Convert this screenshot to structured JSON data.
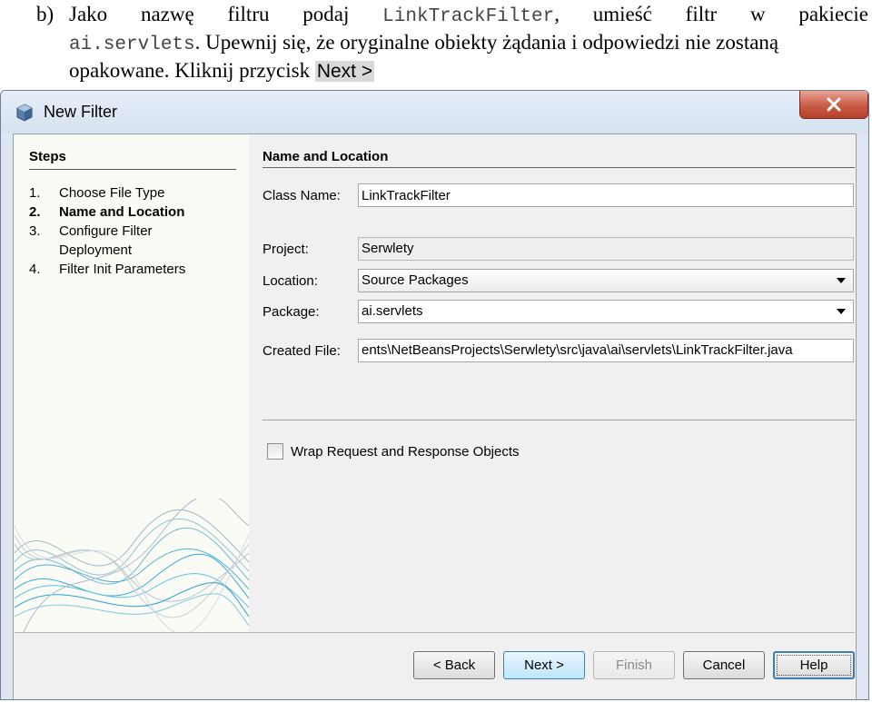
{
  "doc": {
    "marker": "b)",
    "line1_words": [
      "Jako",
      "nazwę",
      "filtru",
      "podaj"
    ],
    "filter_name": "LinkTrackFilter",
    "line1_tail_words": [
      ",",
      "umieść",
      "filtr",
      "w",
      "pakiecie"
    ],
    "package_code": "ai.servlets",
    "line2_text": ". Upewnij się, że oryginalne obiekty żądania i odpowiedzi nie zostaną",
    "line3_text": "opakowane. Kliknij przycisk",
    "button_ref": "Next >"
  },
  "window": {
    "title": "New Filter",
    "close_icon": "close-x-icon"
  },
  "steps": {
    "title": "Steps",
    "items": [
      {
        "num": "1.",
        "label": "Choose File Type"
      },
      {
        "num": "2.",
        "label": "Name and Location"
      },
      {
        "num": "3.",
        "label": "Configure Filter"
      },
      {
        "num": "",
        "label": "Deployment"
      },
      {
        "num": "4.",
        "label": "Filter Init Parameters"
      }
    ]
  },
  "panel": {
    "title": "Name and Location",
    "class_name_label": "Class Name:",
    "class_name_value": "LinkTrackFilter",
    "project_label": "Project:",
    "project_value": "Serwlety",
    "location_label": "Location:",
    "location_value": "Source Packages",
    "package_label": "Package:",
    "package_value": "ai.servlets",
    "created_file_label": "Created File:",
    "created_file_value": "ents\\NetBeansProjects\\Serwlety\\src\\java\\ai\\servlets\\LinkTrackFilter.java",
    "wrap_label": "Wrap Request and Response Objects",
    "wrap_checked": false
  },
  "buttons": {
    "back": "< Back",
    "next": "Next >",
    "finish": "Finish",
    "cancel": "Cancel",
    "help": "Help"
  }
}
